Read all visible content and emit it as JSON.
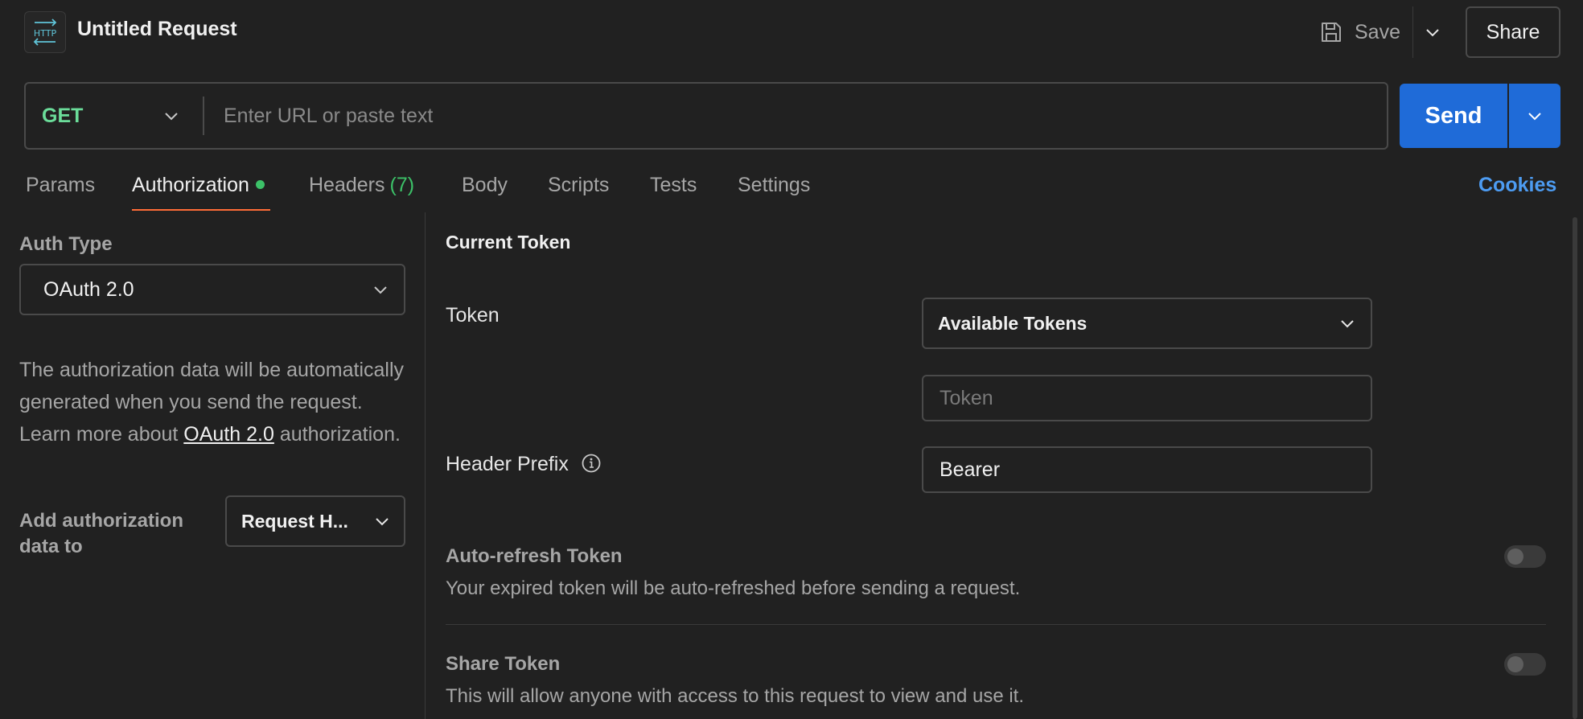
{
  "header": {
    "title": "Untitled Request",
    "app_icon_text": "HTTP",
    "save_label": "Save",
    "share_label": "Share"
  },
  "request": {
    "method": "GET",
    "url_placeholder": "Enter URL or paste text",
    "url_value": "",
    "send_label": "Send"
  },
  "tabs": {
    "params": "Params",
    "authorization": "Authorization",
    "headers": "Headers",
    "headers_count": "(7)",
    "body": "Body",
    "scripts": "Scripts",
    "tests": "Tests",
    "settings": "Settings",
    "cookies": "Cookies",
    "active": "Authorization"
  },
  "auth": {
    "type_label": "Auth Type",
    "type_value": "OAuth 2.0",
    "desc_part1": "The authorization data will be automatically generated when you send the request. Learn more about ",
    "desc_link": "OAuth 2.0",
    "desc_part2": " authorization.",
    "add_to_label": "Add authorization data to",
    "add_to_value": "Request H..."
  },
  "token_panel": {
    "current_token_title": "Current Token",
    "token_label": "Token",
    "available_tokens": "Available Tokens",
    "token_placeholder": "Token",
    "token_value": "",
    "header_prefix_label": "Header Prefix",
    "header_prefix_value": "Bearer",
    "auto_refresh_title": "Auto-refresh Token",
    "auto_refresh_desc": "Your expired token will be auto-refreshed before sending a request.",
    "auto_refresh_on": false,
    "share_title": "Share Token",
    "share_desc": "This will allow anyone with access to this request to view and use it.",
    "share_on": false
  },
  "colors": {
    "background": "#212121",
    "send_blue": "#1f6bd8",
    "method_green": "#6bdd9a",
    "active_tab_underline": "#ff6c37",
    "cookies_link": "#4d9cf2"
  }
}
